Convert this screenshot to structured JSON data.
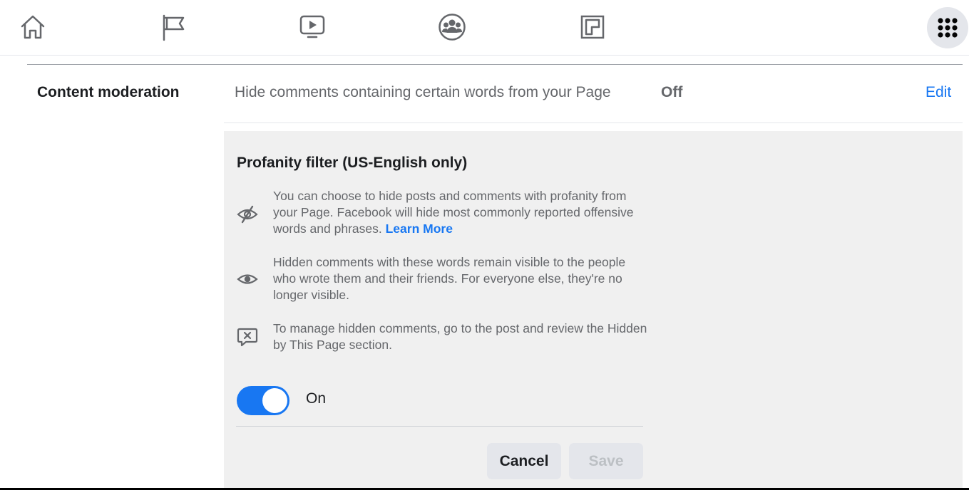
{
  "nav": {
    "icons": [
      "home-icon",
      "flag-icon",
      "watch-icon",
      "groups-icon",
      "gaming-icon",
      "menu-grid-icon"
    ]
  },
  "section": {
    "label": "Content moderation",
    "description": "Hide comments containing certain words from your Page",
    "status": "Off",
    "edit_label": "Edit"
  },
  "panel": {
    "title": "Profanity filter (US-English only)",
    "info": [
      {
        "icon": "eye-slash-icon",
        "text": "You can choose to hide posts and comments with profanity from your Page. Facebook will hide most commonly reported offensive words and phrases.",
        "link": "Learn More"
      },
      {
        "icon": "eye-icon",
        "text": "Hidden comments with these words remain visible to the people who wrote them and their friends. For everyone else, they're no longer visible."
      },
      {
        "icon": "comment-hidden-icon",
        "text": "To manage hidden comments, go to the post and review the Hidden by This Page section."
      }
    ],
    "toggle": {
      "state": true,
      "label": "On"
    },
    "buttons": {
      "cancel": "Cancel",
      "save": "Save"
    }
  },
  "colors": {
    "accent": "#1877f2",
    "panel_bg": "#f0f0f0",
    "text_secondary": "#65676b"
  }
}
